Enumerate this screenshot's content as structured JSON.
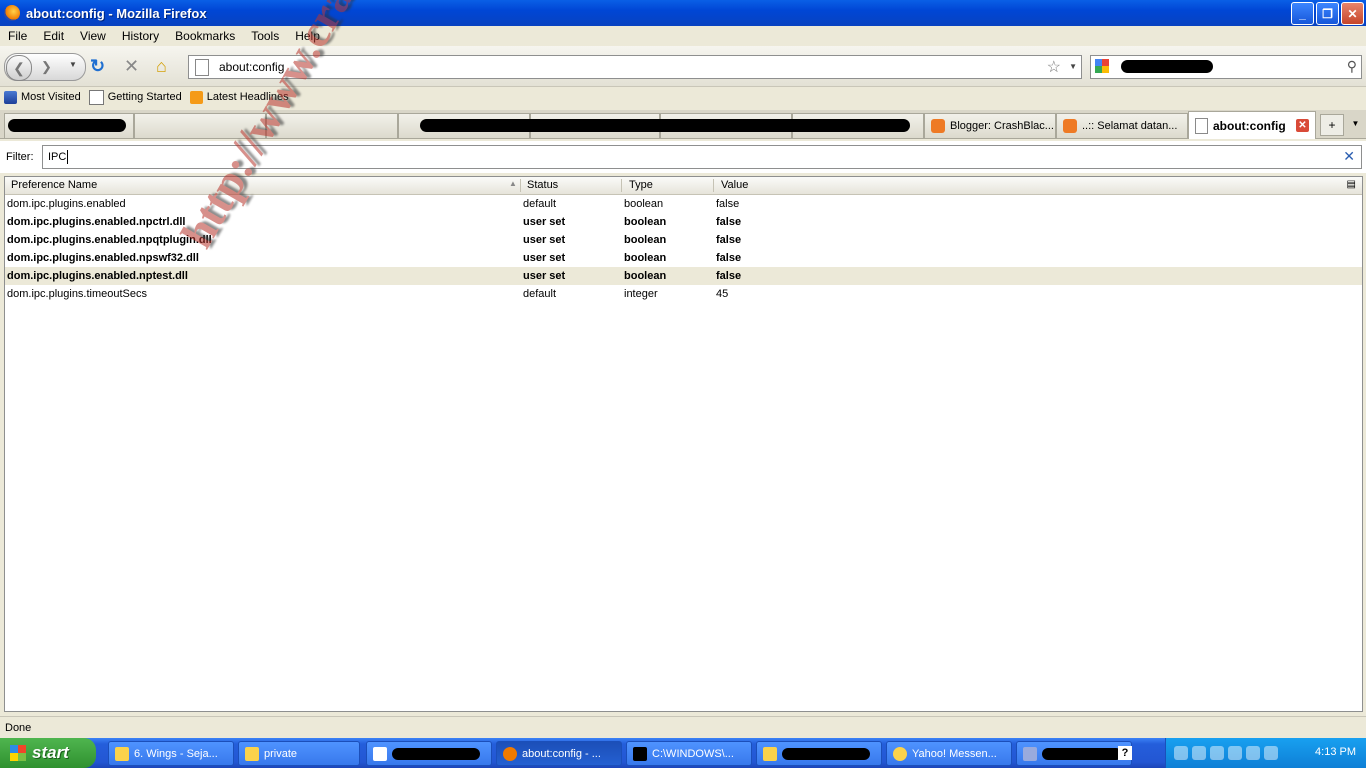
{
  "window": {
    "title": "about:config - Mozilla Firefox"
  },
  "menu": [
    "File",
    "Edit",
    "View",
    "History",
    "Bookmarks",
    "Tools",
    "Help"
  ],
  "nav": {
    "url": "about:config"
  },
  "bookmarks": [
    "Most Visited",
    "Getting Started",
    "Latest Headlines"
  ],
  "tabs": [
    {
      "label": "Blogger: CrashBlac..."
    },
    {
      "label": "..:: Selamat datan..."
    },
    {
      "label": "about:config"
    }
  ],
  "filter": {
    "label": "Filter:",
    "value": "IPC"
  },
  "table": {
    "headers": [
      "Preference Name",
      "Status",
      "Type",
      "Value"
    ],
    "rows": [
      {
        "name": "dom.ipc.plugins.enabled",
        "status": "default",
        "type": "boolean",
        "value": "false"
      },
      {
        "name": "dom.ipc.plugins.enabled.npctrl.dll",
        "status": "user set",
        "type": "boolean",
        "value": "false"
      },
      {
        "name": "dom.ipc.plugins.enabled.npqtplugin.dll",
        "status": "user set",
        "type": "boolean",
        "value": "false"
      },
      {
        "name": "dom.ipc.plugins.enabled.npswf32.dll",
        "status": "user set",
        "type": "boolean",
        "value": "false"
      },
      {
        "name": "dom.ipc.plugins.enabled.nptest.dll",
        "status": "user set",
        "type": "boolean",
        "value": "false"
      },
      {
        "name": "dom.ipc.plugins.timeoutSecs",
        "status": "default",
        "type": "integer",
        "value": "45"
      }
    ]
  },
  "status": "Done",
  "taskbar": {
    "start": "start",
    "items": [
      "6. Wings - Seja...",
      "private",
      "about:config - ...",
      "C:\\WINDOWS\\...",
      "Yahoo! Messen..."
    ],
    "clock": "4:13 PM"
  },
  "watermark": "http://www.crash-black.blogspot.com"
}
